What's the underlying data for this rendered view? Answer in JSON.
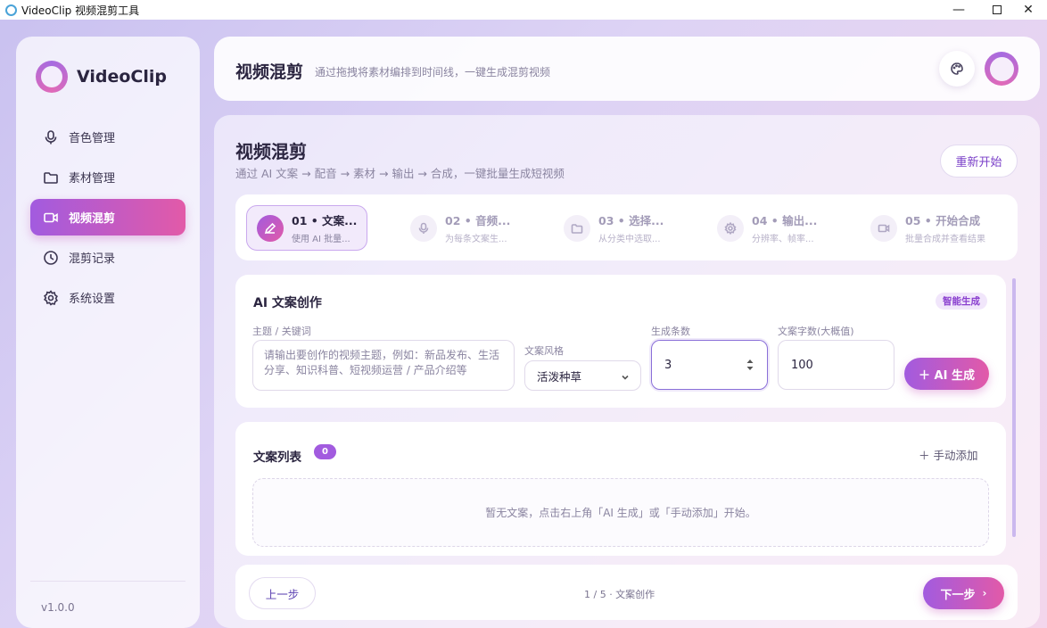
{
  "window": {
    "title": "VideoClip 视频混剪工具",
    "minimize": "—",
    "close": "✕"
  },
  "sidebar": {
    "logo": "VideoClip",
    "items": [
      {
        "label": "音色管理",
        "icon": "mic-icon"
      },
      {
        "label": "素材管理",
        "icon": "folder-icon"
      },
      {
        "label": "视频混剪",
        "icon": "video-icon",
        "active": true
      },
      {
        "label": "混剪记录",
        "icon": "history-icon"
      },
      {
        "label": "系统设置",
        "icon": "gear-icon"
      }
    ],
    "version": "v1.0.0"
  },
  "header": {
    "title": "视频混剪",
    "subtitle": "通过拖拽将素材编排到时间线，一键生成混剪视频"
  },
  "page": {
    "title": "视频混剪",
    "subtitle": "通过 AI 文案 → 配音 → 素材 → 输出 → 合成，一键批量生成短视频",
    "restart": "重新开始"
  },
  "steps": [
    {
      "title": "01 • 文案...",
      "desc": "使用 AI 批量...",
      "icon": "pen-icon",
      "active": true
    },
    {
      "title": "02 • 音频...",
      "desc": "为每条文案生...",
      "icon": "mic-icon"
    },
    {
      "title": "03 • 选择...",
      "desc": "从分类中选取...",
      "icon": "folder-icon"
    },
    {
      "title": "04 • 输出...",
      "desc": "分辨率、帧率...",
      "icon": "gear-icon"
    },
    {
      "title": "05 • 开始合成",
      "desc": "批量合成并查看结果",
      "icon": "video-icon"
    }
  ],
  "ai": {
    "title": "AI 文案创作",
    "badge": "智能生成",
    "topic_label": "主题 / 关键词",
    "topic_placeholder": "请输出要创作的视频主题，例如：新品发布、生活分享、知识科普、短视频运营 / 产品介绍等",
    "style_label": "文案风格",
    "style_value": "活泼种草",
    "count_label": "生成条数",
    "count_value": "3",
    "length_label": "文案字数(大概值)",
    "length_value": "100",
    "generate": "＋ AI 生成"
  },
  "list": {
    "title": "文案列表",
    "count": "0",
    "manual_add": "＋ 手动添加",
    "empty": "暂无文案，点击右上角「AI 生成」或「手动添加」开始。"
  },
  "footer": {
    "prev": "上一步",
    "progress": "1 / 5 · 文案创作",
    "next": "下一步",
    "next_arrow": "›"
  },
  "colors": {
    "accent_start": "#a25bdf",
    "accent_end": "#e25aa8"
  }
}
